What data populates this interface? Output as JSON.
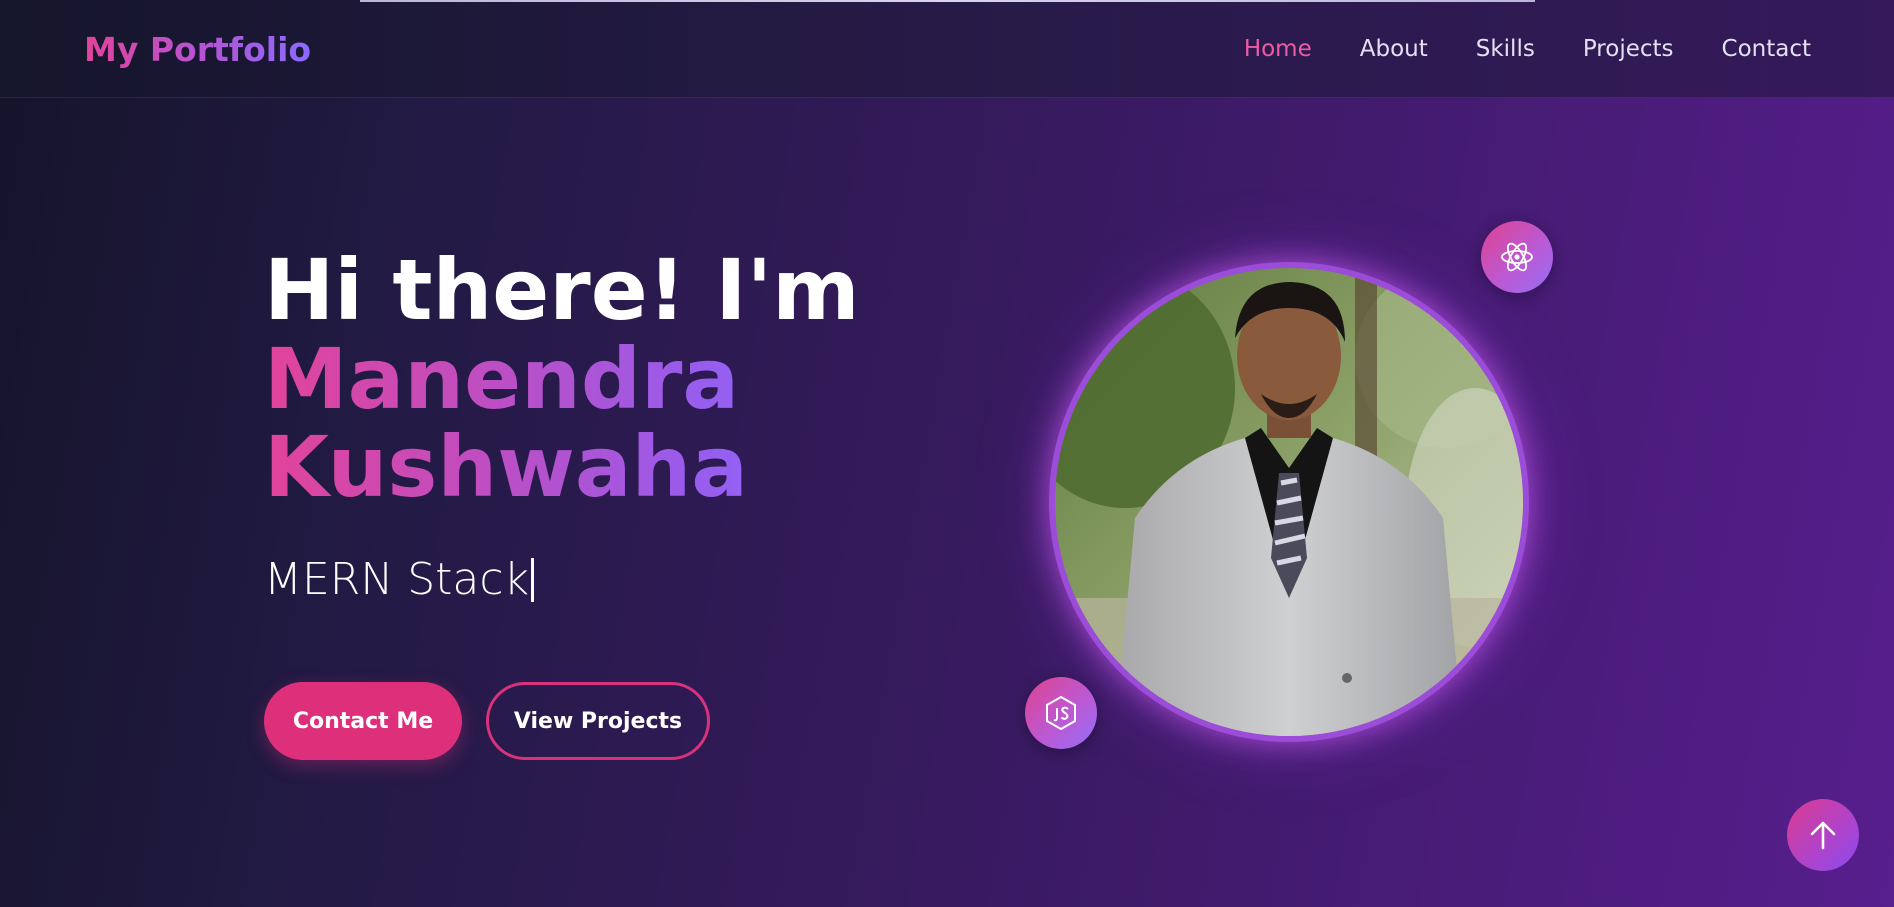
{
  "header": {
    "logo": "My Portfolio",
    "nav": [
      {
        "label": "Home",
        "active": true
      },
      {
        "label": "About",
        "active": false
      },
      {
        "label": "Skills",
        "active": false
      },
      {
        "label": "Projects",
        "active": false
      },
      {
        "label": "Contact",
        "active": false
      }
    ]
  },
  "hero": {
    "greeting": "Hi there! I'm",
    "first_name": "Manendra",
    "last_name": "Kushwaha",
    "typed_role": "MERN Stack",
    "buttons": {
      "contact": "Contact Me",
      "projects": "View Projects"
    }
  },
  "icons": {
    "react_badge": "react-icon",
    "js_badge": "nodejs-icon",
    "scroll_top": "arrow-up-icon"
  },
  "colors": {
    "accent_pink": "#dd2f7a",
    "accent_purple": "#8a6bff",
    "active_nav": "#ef5aa7"
  }
}
